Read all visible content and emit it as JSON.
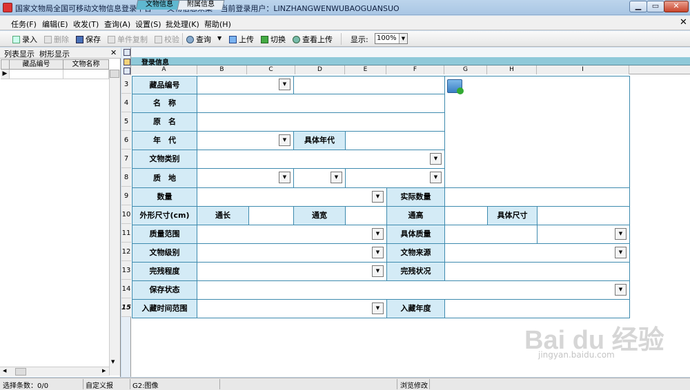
{
  "window": {
    "title": "国家文物局全国可移动文物信息登录平台——文物信息采集 --当前登录用户：LINZHANGWENWUBAOGUANSUO"
  },
  "menu": [
    "任务(F)",
    "编辑(E)",
    "收发(T)",
    "查询(A)",
    "设置(S)",
    "批处理(K)",
    "帮助(H)"
  ],
  "toolbar": {
    "enter": "录入",
    "delete": "删除",
    "save": "保存",
    "copy": "单件复制",
    "verify": "校验",
    "query": "查询",
    "upload": "上传",
    "switch": "切换",
    "view_upload": "查看上传",
    "display_label": "显示:",
    "zoom": "100%"
  },
  "left": {
    "list_view": "列表显示",
    "tree_view": "树形显示",
    "close": "✕",
    "col1": "藏品编号",
    "col2": "文物名称"
  },
  "tabs": [
    "文物信息",
    "附属信息"
  ],
  "section": "登录信息",
  "columns": [
    "A",
    "B",
    "C",
    "D",
    "E",
    "F",
    "G",
    "H",
    "I"
  ],
  "rows": [
    "3",
    "4",
    "5",
    "6",
    "7",
    "8",
    "9",
    "10",
    "11",
    "12",
    "13",
    "14",
    "15"
  ],
  "form": {
    "collection_no": "藏品编号",
    "name": "名　称",
    "original_name": "原　名",
    "era": "年　代",
    "specific_era": "具体年代",
    "category": "文物类别",
    "material": "质　地",
    "quantity": "数量",
    "actual_quantity": "实际数量",
    "dimensions": "外形尺寸(cm)",
    "length": "通长",
    "width": "通宽",
    "height": "通高",
    "specific_size": "具体尺寸",
    "mass_range": "质量范围",
    "specific_mass": "具体质量",
    "grade": "文物级别",
    "source": "文物来源",
    "completeness": "完残程度",
    "condition": "完残状况",
    "preservation": "保存状态",
    "entry_time": "入藏时间范围",
    "entry_year": "入藏年度"
  },
  "status": {
    "selected": "选择条数：0/0",
    "custom": "自定义报",
    "cell": "G2:图像",
    "mode": "浏览修改"
  },
  "watermark": {
    "brand": "Bai du 经验",
    "url": "jingyan.baidu.com"
  }
}
